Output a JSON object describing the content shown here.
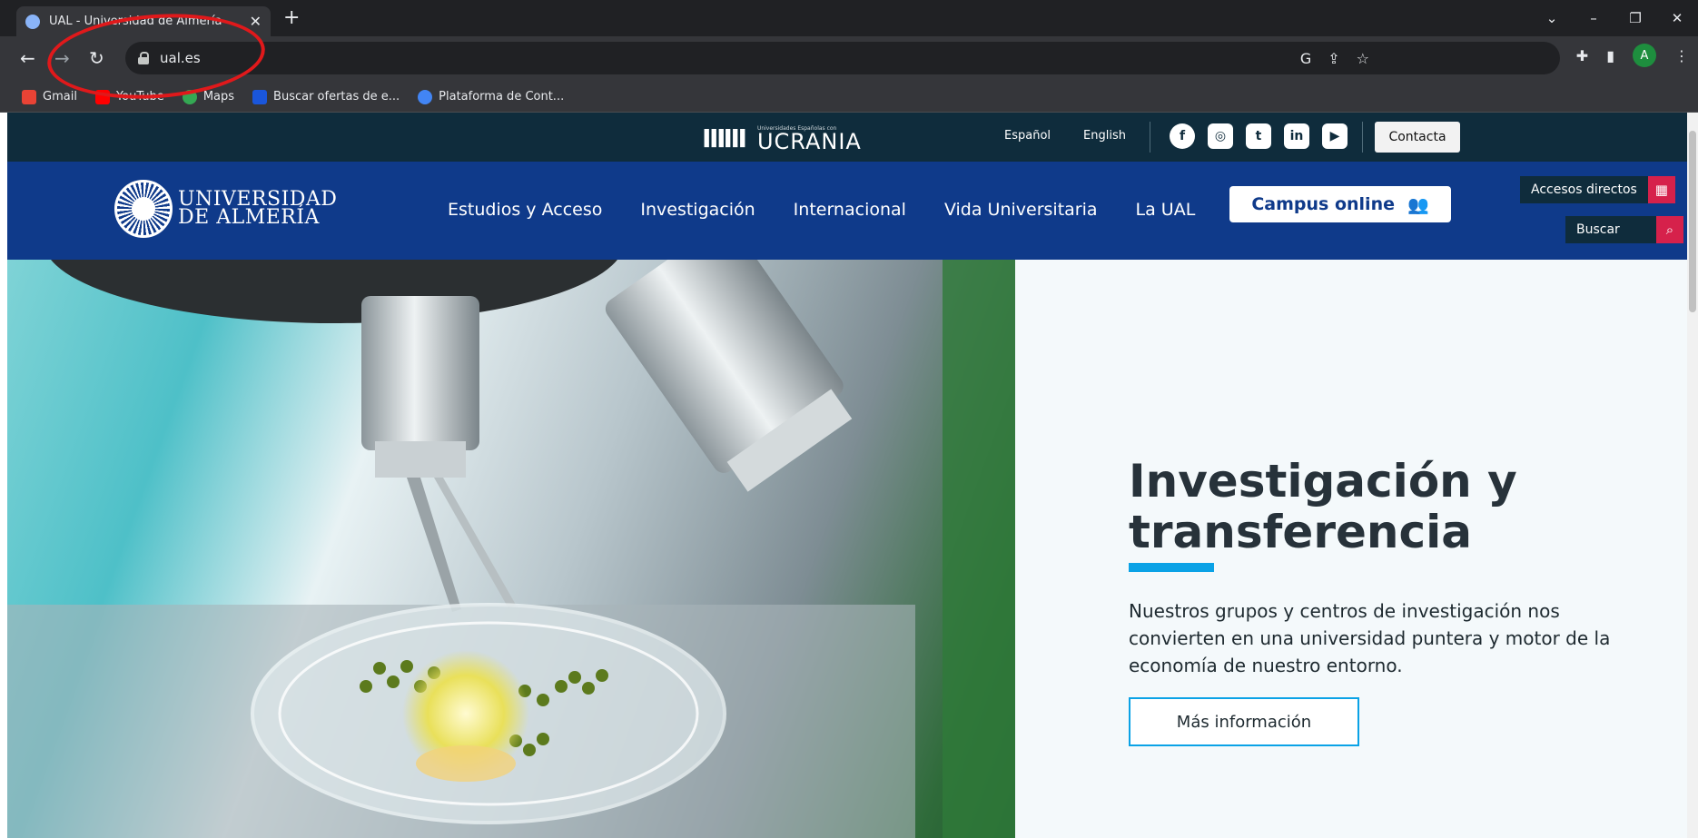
{
  "browser": {
    "tab_title": "UAL - Universidad de Almería",
    "close_glyph": "✕",
    "new_tab_glyph": "+",
    "url": "ual.es",
    "window_controls": {
      "dropdown": "⌄",
      "minimize": "–",
      "restore": "❐",
      "close": "✕"
    },
    "nav": {
      "back": "←",
      "forward": "→",
      "reload": "↻"
    },
    "profile_initial": "A",
    "bookmarks": [
      {
        "label": "Gmail",
        "color": "#ea4335"
      },
      {
        "label": "YouTube",
        "color": "#ff0000"
      },
      {
        "label": "Maps",
        "color": "#34a853"
      },
      {
        "label": "Buscar ofertas de e...",
        "color": "#1a56db"
      },
      {
        "label": "Plataforma de Cont...",
        "color": "#4285f4"
      }
    ]
  },
  "site": {
    "topbar": {
      "ucrania_small": "Universidades Españolas con",
      "ucrania_big": "UCRANIA",
      "lang_es": "Español",
      "lang_en": "English",
      "contact": "Contacta",
      "socials": {
        "facebook": "f",
        "instagram": "◎",
        "twitter": "t",
        "linkedin": "in",
        "youtube": "▶"
      }
    },
    "logo": {
      "line1": "UNIVERSIDAD",
      "line2": "DE ALMERÍA"
    },
    "nav": [
      "Estudios y Acceso",
      "Investigación",
      "Internacional",
      "Vida Universitaria",
      "La UAL"
    ],
    "campus_online": "Campus online",
    "accesos_directos": "Accesos directos",
    "buscar": "Buscar",
    "hero": {
      "title": "Investigación y transferencia",
      "description": "Nuestros grupos y centros de investigación nos convierten en una universidad puntera y motor de la economía de nuestro entorno.",
      "button": "Más información"
    }
  },
  "colors": {
    "topbar": "#0f2c3c",
    "nav": "#0f3a8a",
    "accent": "#0aa2e6",
    "action": "#d6214b"
  }
}
